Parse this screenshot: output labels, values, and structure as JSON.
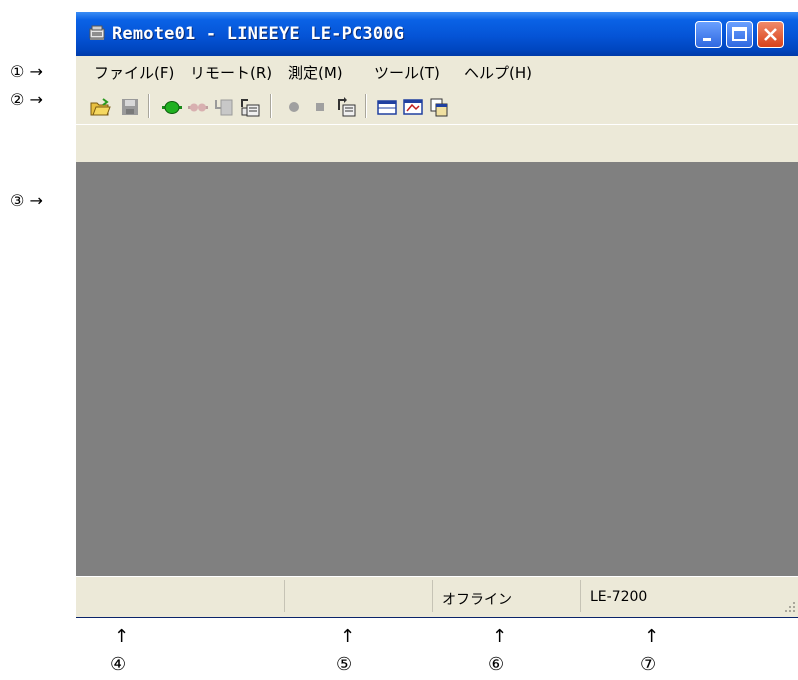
{
  "window": {
    "title": "Remote01 - LINEEYE LE-PC300G"
  },
  "menu": {
    "items": [
      {
        "label": "ファイル(F)"
      },
      {
        "label": "リモート(R)"
      },
      {
        "label": "測定(M)"
      },
      {
        "label": "ツール(T)"
      },
      {
        "label": "ヘルプ(H)"
      }
    ]
  },
  "toolbar": {
    "buttons": [
      {
        "icon": "open-folder-icon"
      },
      {
        "icon": "save-icon"
      },
      {
        "icon": "connect-icon"
      },
      {
        "icon": "disconnect-icon"
      },
      {
        "icon": "download-config-icon"
      },
      {
        "icon": "upload-config-icon"
      },
      {
        "icon": "start-record-icon"
      },
      {
        "icon": "stop-icon"
      },
      {
        "icon": "transfer-data-icon"
      },
      {
        "icon": "window-layout-icon"
      },
      {
        "icon": "display-icon"
      },
      {
        "icon": "copy-icon"
      }
    ]
  },
  "status": {
    "pane1": "",
    "pane2": "",
    "pane3": "オフライン",
    "pane4": "LE-7200"
  },
  "annotations": {
    "left": [
      "①",
      "②",
      "③"
    ],
    "bottom": [
      "④",
      "⑤",
      "⑥",
      "⑦"
    ],
    "right_arrow": "→",
    "up_arrow": "↑"
  },
  "colors": {
    "titlebar": "#0554d6",
    "chrome": "#ece9d8",
    "client": "#808080"
  }
}
